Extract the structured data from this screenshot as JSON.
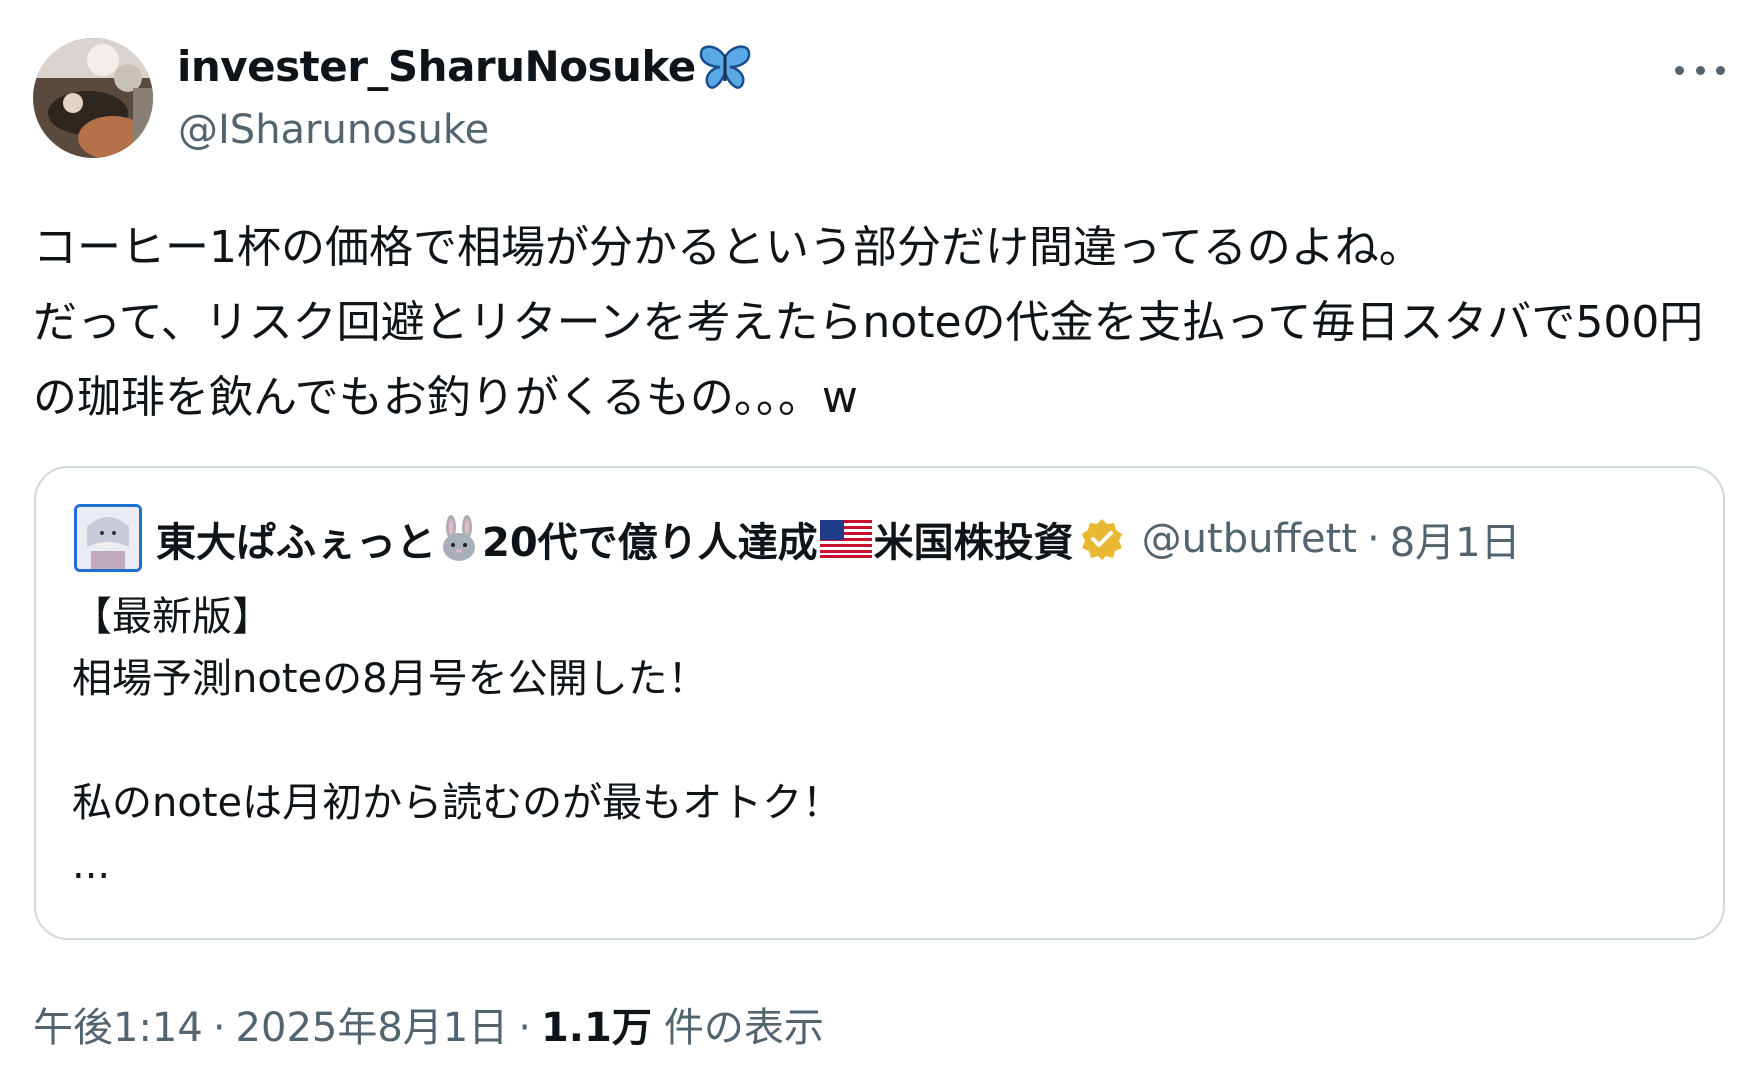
{
  "author": {
    "display_name": "invester_SharuNosuke",
    "name_emoji": "butterfly-icon",
    "handle": "@ISharunosuke"
  },
  "more_button_label": "More",
  "tweet": {
    "text": "コーヒー1杯の価格で相場が分かるという部分だけ間違ってるのよね。\nだって、リスク回避とリターンを考えたらnoteの代金を支払って毎日スタバで500円の珈琲を飲んでもお釣りがくるもの。。。w"
  },
  "quote": {
    "name_part1": "東大ぱふぇっと",
    "name_part2": "20代で億り人達成",
    "name_part3": "米国株投資",
    "emoji_1": "rabbit-icon",
    "emoji_2": "us-flag-icon",
    "verified_icon": "verified-badge-icon",
    "handle": "@utbuffett",
    "separator": "·",
    "date": "8月1日",
    "text": "【最新版】\n相場予測noteの8月号を公開した！\n\n私のnoteは月初から読むのが最もオトク！\n..."
  },
  "meta": {
    "time": "午後1:14",
    "separator": "·",
    "date": "2025年8月1日",
    "separator2": "·",
    "views_count": "1.1万",
    "views_label": "件の表示"
  },
  "colors": {
    "text": "#0f1419",
    "secondary": "#536471",
    "border": "#cfd9de",
    "verified": "#e8b832"
  }
}
